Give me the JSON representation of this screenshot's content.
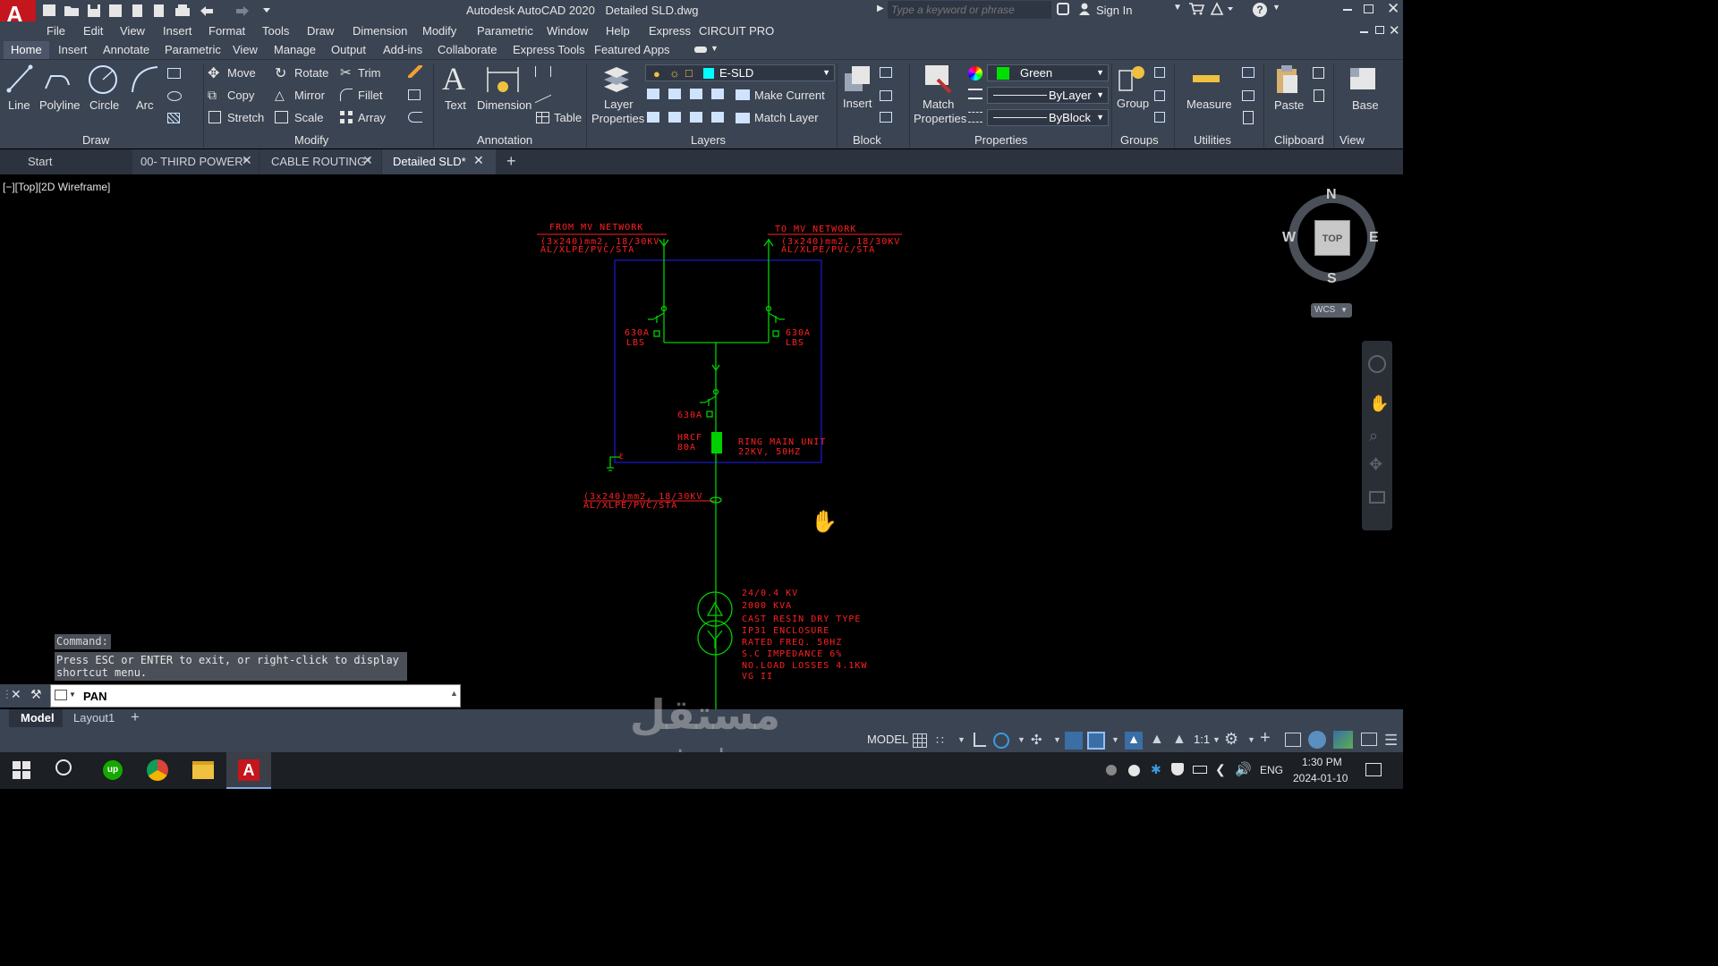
{
  "app": {
    "title": "Autodesk AutoCAD 2020",
    "file": "Detailed SLD.dwg",
    "search_placeholder": "Type a keyword or phrase",
    "sign_in": "Sign In"
  },
  "menu": [
    "File",
    "Edit",
    "View",
    "Insert",
    "Format",
    "Tools",
    "Draw",
    "Dimension",
    "Modify",
    "Parametric",
    "Window",
    "Help",
    "Express",
    "CIRCUIT PRO"
  ],
  "ribbon_tabs": [
    "Home",
    "Insert",
    "Annotate",
    "Parametric",
    "View",
    "Manage",
    "Output",
    "Add-ins",
    "Collaborate",
    "Express Tools",
    "Featured Apps"
  ],
  "ribbon": {
    "draw": {
      "line": "Line",
      "polyline": "Polyline",
      "circle": "Circle",
      "arc": "Arc",
      "title": "Draw"
    },
    "modify": {
      "move": "Move",
      "rotate": "Rotate",
      "trim": "Trim",
      "copy": "Copy",
      "mirror": "Mirror",
      "fillet": "Fillet",
      "stretch": "Stretch",
      "scale": "Scale",
      "array": "Array",
      "title": "Modify"
    },
    "annotation": {
      "text": "Text",
      "dimension": "Dimension",
      "table": "Table",
      "title": "Annotation"
    },
    "layers": {
      "layer_properties_1": "Layer",
      "layer_properties_2": "Properties",
      "current_layer": "E-SLD",
      "make_current": "Make Current",
      "match_layer": "Match Layer",
      "title": "Layers",
      "layer_color": "#00ffff"
    },
    "block": {
      "insert": "Insert",
      "title": "Block"
    },
    "properties": {
      "match_1": "Match",
      "match_2": "Properties",
      "color": "Green",
      "color_swatch": "#00e000",
      "linetype": "ByLayer",
      "lineweight": "ByBlock",
      "title": "Properties"
    },
    "groups": {
      "group": "Group",
      "title": "Groups"
    },
    "utilities": {
      "measure": "Measure",
      "title": "Utilities"
    },
    "clipboard": {
      "paste": "Paste",
      "title": "Clipboard"
    },
    "view": {
      "base": "Base",
      "title": "View"
    }
  },
  "doc_tabs": [
    "Start",
    "00- THIRD POWER*",
    "CABLE ROUTING*",
    "Detailed SLD*"
  ],
  "viewport_label": "[−][Top][2D Wireframe]",
  "viewcube": {
    "n": "N",
    "s": "S",
    "e": "E",
    "w": "W",
    "top": "TOP",
    "wcs": "WCS"
  },
  "drawing": {
    "from_mv": "FROM MV NETWORK",
    "to_mv": "TO MV NETWORK",
    "cable_left_1": "(3x240)mm2, 18/30KV",
    "cable_left_2": "AL/XLPE/PVC/STA",
    "cable_right_1": "(3x240)mm2, 18/30KV",
    "cable_right_2": "AL/XLPE/PVC/STA",
    "lbs_left_1": "630A",
    "lbs_left_2": "LBS",
    "lbs_right_1": "630A",
    "lbs_right_2": "LBS",
    "breaker_rating": "630A",
    "hrcf_1": "HRCF",
    "hrcf_2": "80A",
    "rmu_1": "RING MAIN UNIT",
    "rmu_2": "22KV, 50HZ",
    "earth": "E",
    "cable_bottom_1": "(3x240)mm2, 18/30KV",
    "cable_bottom_2": "AL/XLPE/PVC/STA",
    "tx": [
      "24/0.4 KV",
      "2000 KVA",
      "CAST RESIN DRY TYPE",
      "IP31 ENCLOSURE",
      "RATED FREQ. 50HZ",
      "S.C IMPEDANCE 6%",
      "NO.LOAD LOSSES 4.1KW",
      "VG II"
    ]
  },
  "command": {
    "label": "Command:",
    "message_1": "Press ESC or ENTER to exit, or right-click to display",
    "message_2": "shortcut menu.",
    "input": "PAN"
  },
  "layout_tabs": [
    "Model",
    "Layout1"
  ],
  "status": {
    "model": "MODEL",
    "scale": "1:1"
  },
  "watermark": {
    "arabic": "مستقل",
    "latin": "mostaql.com"
  },
  "taskbar": {
    "lang": "ENG",
    "time": "1:30 PM",
    "date": "2024-01-10"
  }
}
